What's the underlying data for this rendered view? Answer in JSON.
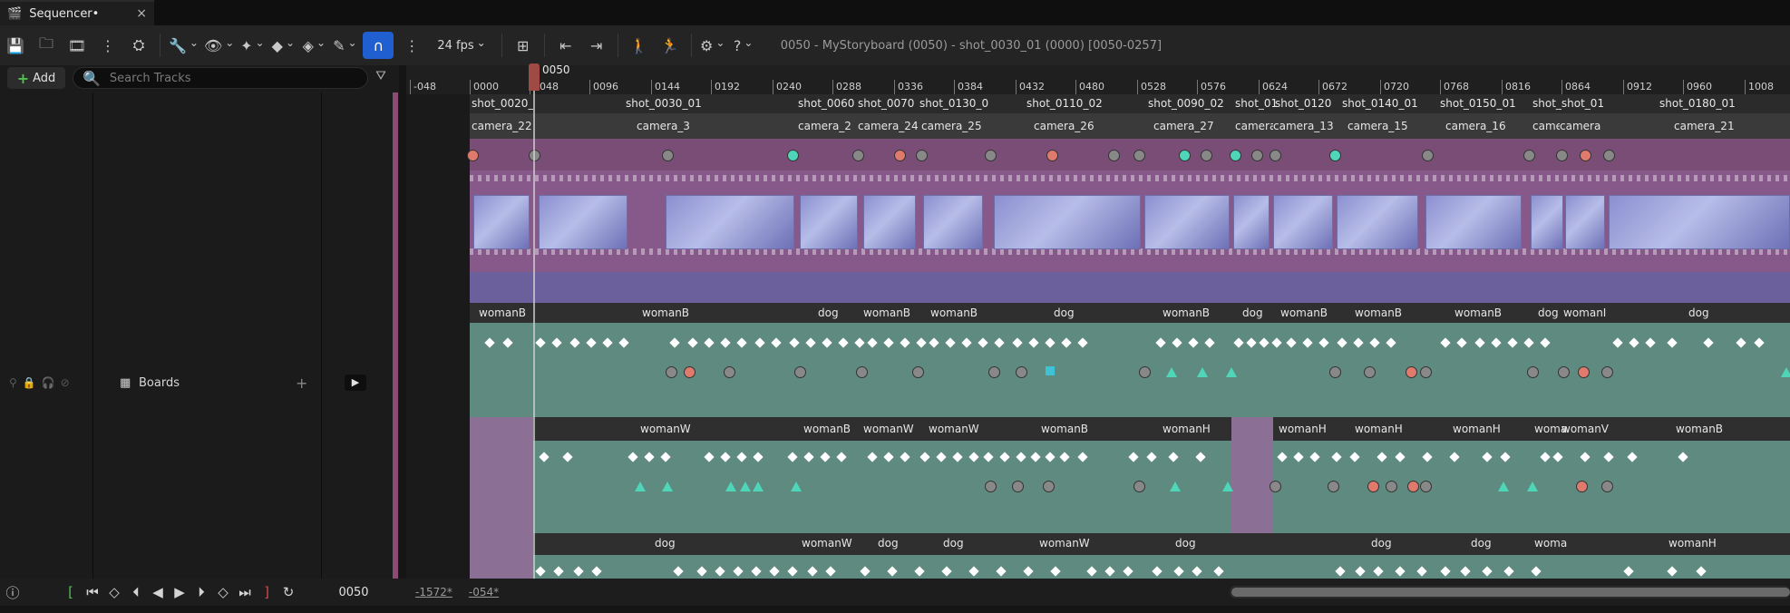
{
  "tab": {
    "title": "Sequencer•",
    "close": "×"
  },
  "toolbar": {
    "fps": "24 fps",
    "breadcrumb": "0050 - MyStoryboard (0050) - shot_0030_01 (0000) [0050-0257]",
    "icons": [
      "save-icon",
      "browse-icon",
      "clapper-icon",
      "more-icon",
      "render-icon",
      "wrench-icon",
      "eye-icon",
      "transform-icon",
      "key-icon",
      "key-interp-icon",
      "paint-icon",
      "magnet-icon",
      "fps-icon",
      "curve-editor-icon",
      "step-back-icon",
      "step-fwd-icon",
      "actor-icon",
      "actor-walk-icon",
      "gear-icon",
      "help-icon"
    ]
  },
  "left_panel": {
    "add_label": "Add",
    "search_placeholder": "Search Tracks",
    "track_name": "Boards"
  },
  "ruler": {
    "playhead_frame": "0050",
    "ticks": [
      "-048",
      "0000",
      "0048",
      "0096",
      "0144",
      "0192",
      "0240",
      "0288",
      "0336",
      "0384",
      "0432",
      "0480",
      "0528",
      "0576",
      "0624",
      "0672",
      "0720",
      "0768",
      "0816",
      "0864",
      "0912",
      "0960",
      "1008"
    ]
  },
  "shots": [
    "shot_0020_",
    "shot_0030_01",
    "shot_0060",
    "shot_0070",
    "shot_0130_0",
    "shot_0110_02",
    "shot_0090_02",
    "shot_01",
    "shot_0120",
    "shot_0140_01",
    "shot_0150_01",
    "shot_shot_01",
    "shot_0180_01"
  ],
  "cameras": [
    "camera_22",
    "camera_3",
    "camera_2",
    "camera_24",
    "camera_25",
    "camera_26",
    "camera_27",
    "camera",
    "camera_13",
    "camera_15",
    "camera_16",
    "came",
    "camera",
    "camera_21"
  ],
  "tracks": {
    "row1": [
      "womanB",
      "womanB",
      "dog",
      "womanB",
      "womanB",
      "dog",
      "womanB",
      "dog",
      "womanB",
      "womanB",
      "womanB",
      "dog",
      "womanI",
      "dog"
    ],
    "row2": [
      "womanW",
      "womanB",
      "womanW",
      "womanW",
      "womanB",
      "womanH",
      "womanH",
      "womanH",
      "womanH",
      "woma",
      "womanV",
      "womanB"
    ],
    "row3": [
      "dog",
      "womanW",
      "dog",
      "dog",
      "womanW",
      "dog",
      "dog",
      "dog",
      "woma",
      "womanH"
    ]
  },
  "transport": {
    "current_frame": "0050",
    "range_start": "-1572*",
    "range_end": "-054*"
  },
  "colors": {
    "accent": "#1f5fd0",
    "playhead": "#a04a45",
    "track_teal": "#5f8a80",
    "film": "#87598a",
    "camera_row": "#7a4d77"
  }
}
